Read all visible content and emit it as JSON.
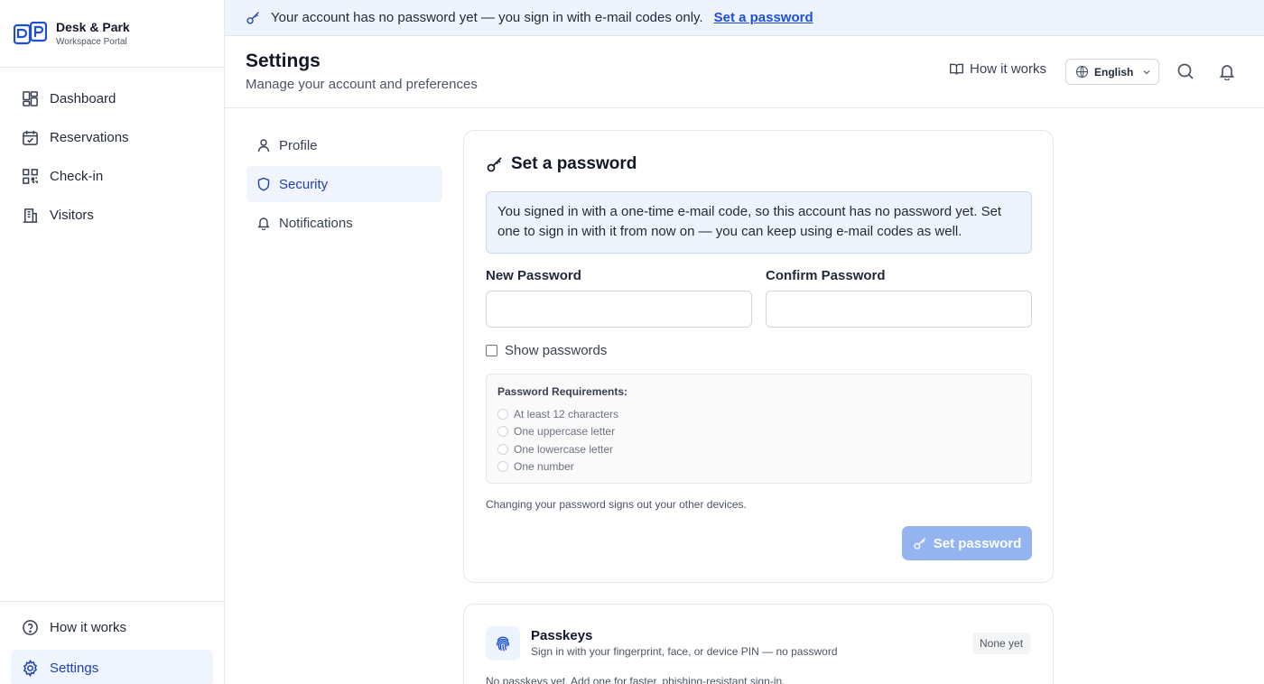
{
  "brand": {
    "name": "Desk & Park",
    "tagline": "Workspace Portal"
  },
  "sidebar": {
    "items": [
      {
        "label": "Dashboard",
        "icon": "dashboard-icon"
      },
      {
        "label": "Reservations",
        "icon": "calendar-icon"
      },
      {
        "label": "Check-in",
        "icon": "qr-code-icon"
      },
      {
        "label": "Visitors",
        "icon": "building-icon"
      }
    ],
    "bottom": [
      {
        "label": "How it works",
        "icon": "help-circle-icon"
      },
      {
        "label": "Settings",
        "icon": "gear-icon",
        "active": true
      }
    ]
  },
  "banner": {
    "text": "Your account has no password yet — you sign in with e-mail codes only.",
    "link": "Set a password",
    "icon": "key-icon"
  },
  "header": {
    "title": "Settings",
    "subtitle": "Manage your account and preferences",
    "how_it_works": "How it works",
    "language": "English"
  },
  "subnav": {
    "items": [
      {
        "label": "Profile",
        "icon": "user-icon"
      },
      {
        "label": "Security",
        "icon": "shield-icon",
        "active": true
      },
      {
        "label": "Notifications",
        "icon": "bell-icon"
      }
    ]
  },
  "password_card": {
    "title": "Set a password",
    "info": "You signed in with a one-time e-mail code, so this account has no password yet. Set one to sign in with it from now on — you can keep using e-mail codes as well.",
    "new_label": "New Password",
    "new_value": "",
    "confirm_label": "Confirm Password",
    "confirm_value": "",
    "show_passwords": "Show passwords",
    "show_checked": false,
    "requirements_title": "Password Requirements:",
    "requirements": [
      "At least 12 characters",
      "One uppercase letter",
      "One lowercase letter",
      "One number"
    ],
    "note": "Changing your password signs out your other devices.",
    "submit": "Set password"
  },
  "passkeys_card": {
    "title": "Passkeys",
    "subtitle": "Sign in with your fingerprint, face, or device PIN — no password",
    "badge": "None yet",
    "empty": "No passkeys yet. Add one for faster, phishing-resistant sign-in."
  },
  "colors": {
    "accent": "#1d4ed8",
    "button_disabled": "#93b4f0",
    "banner_bg": "#eef4fd"
  }
}
